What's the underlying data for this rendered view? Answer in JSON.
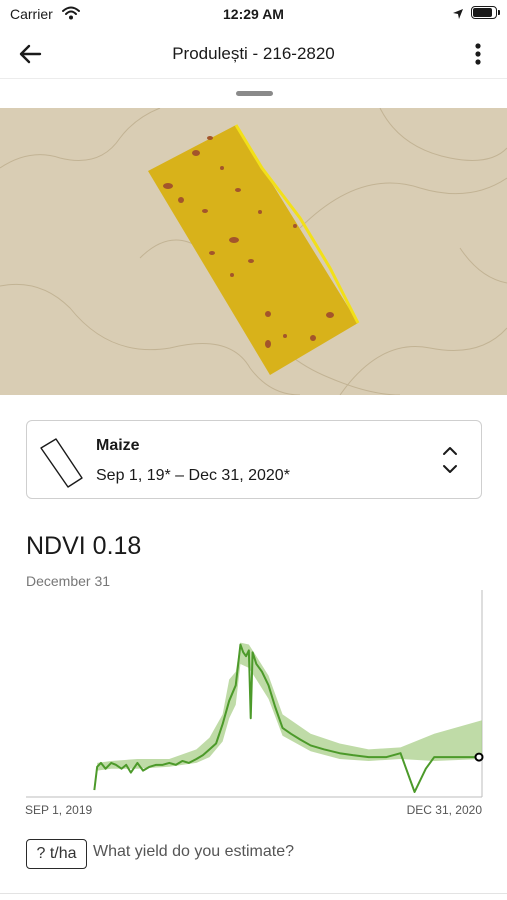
{
  "status_bar": {
    "carrier": "Carrier",
    "time": "12:29 AM",
    "battery_fraction": 0.92
  },
  "nav": {
    "title": "Produlești - 216-2820",
    "back_icon": "arrow-left-icon",
    "more_icon": "vertical-ellipsis-icon"
  },
  "crop": {
    "name": "Maize",
    "date_range": "Sep 1, 19* – Dec 31, 2020*",
    "field_icon": "field-shape-icon",
    "chevron_icon": "up-down-chevron-icon"
  },
  "ndvi": {
    "title": "NDVI 0.18",
    "date": "December 31"
  },
  "colors": {
    "field": "#d8b21a",
    "map_bg": "#d9cdb4",
    "line": "#4c9a2a",
    "band": "#a9cf8a",
    "accent": "#000000"
  },
  "chart_data": {
    "type": "line",
    "xlabel": "",
    "ylabel": "",
    "x_start_label": "SEP 1, 2019",
    "x_end_label": "DEC 31, 2020",
    "x_range": [
      "2019-09-01",
      "2020-12-31"
    ],
    "ylim": [
      0,
      1
    ],
    "series": [
      {
        "points": [
          [
            "2019-11-13",
            0.01
          ],
          [
            "2019-11-16",
            0.13
          ],
          [
            "2019-11-20",
            0.15
          ],
          [
            "2019-11-25",
            0.12
          ],
          [
            "2019-12-01",
            0.15
          ],
          [
            "2019-12-06",
            0.14
          ],
          [
            "2019-12-12",
            0.12
          ],
          [
            "2019-12-17",
            0.14
          ],
          [
            "2019-12-22",
            0.1
          ],
          [
            "2019-12-29",
            0.15
          ],
          [
            "2020-01-04",
            0.11
          ],
          [
            "2020-01-11",
            0.13
          ],
          [
            "2020-01-18",
            0.14
          ],
          [
            "2020-01-25",
            0.14
          ],
          [
            "2020-02-01",
            0.15
          ],
          [
            "2020-02-08",
            0.14
          ],
          [
            "2020-02-15",
            0.16
          ],
          [
            "2020-02-22",
            0.15
          ],
          [
            "2020-03-01",
            0.17
          ],
          [
            "2020-03-08",
            0.19
          ],
          [
            "2020-03-15",
            0.22
          ],
          [
            "2020-03-22",
            0.25
          ],
          [
            "2020-03-29",
            0.35
          ],
          [
            "2020-04-05",
            0.47
          ],
          [
            "2020-04-12",
            0.55
          ],
          [
            "2020-04-17",
            0.76
          ],
          [
            "2020-04-20",
            0.72
          ],
          [
            "2020-04-23",
            0.7
          ],
          [
            "2020-04-26",
            0.73
          ],
          [
            "2020-04-28",
            0.38
          ],
          [
            "2020-04-30",
            0.72
          ],
          [
            "2020-05-04",
            0.66
          ],
          [
            "2020-05-10",
            0.62
          ],
          [
            "2020-05-17",
            0.55
          ],
          [
            "2020-05-24",
            0.44
          ],
          [
            "2020-06-01",
            0.33
          ],
          [
            "2020-06-10",
            0.3
          ],
          [
            "2020-06-20",
            0.27
          ],
          [
            "2020-07-01",
            0.24
          ],
          [
            "2020-07-15",
            0.22
          ],
          [
            "2020-08-01",
            0.2
          ],
          [
            "2020-08-15",
            0.19
          ],
          [
            "2020-09-01",
            0.18
          ],
          [
            "2020-09-20",
            0.18
          ],
          [
            "2020-10-05",
            0.2
          ],
          [
            "2020-10-20",
            0.0
          ],
          [
            "2020-11-01",
            0.12
          ],
          [
            "2020-11-10",
            0.18
          ],
          [
            "2020-12-01",
            0.18
          ],
          [
            "2020-12-31",
            0.18
          ]
        ]
      }
    ],
    "band_upper": [
      [
        "2019-11-16",
        0.15
      ],
      [
        "2019-12-01",
        0.16
      ],
      [
        "2019-12-29",
        0.17
      ],
      [
        "2020-02-01",
        0.17
      ],
      [
        "2020-03-01",
        0.22
      ],
      [
        "2020-03-15",
        0.28
      ],
      [
        "2020-03-29",
        0.4
      ],
      [
        "2020-04-05",
        0.58
      ],
      [
        "2020-04-12",
        0.62
      ],
      [
        "2020-04-17",
        0.77
      ],
      [
        "2020-04-26",
        0.76
      ],
      [
        "2020-05-04",
        0.7
      ],
      [
        "2020-05-17",
        0.6
      ],
      [
        "2020-06-01",
        0.4
      ],
      [
        "2020-07-01",
        0.3
      ],
      [
        "2020-08-01",
        0.25
      ],
      [
        "2020-09-01",
        0.22
      ],
      [
        "2020-10-05",
        0.23
      ],
      [
        "2020-11-10",
        0.3
      ],
      [
        "2020-12-31",
        0.37
      ]
    ],
    "band_lower": [
      [
        "2019-11-16",
        0.11
      ],
      [
        "2019-12-01",
        0.12
      ],
      [
        "2019-12-29",
        0.12
      ],
      [
        "2020-02-01",
        0.13
      ],
      [
        "2020-03-01",
        0.15
      ],
      [
        "2020-03-15",
        0.18
      ],
      [
        "2020-03-29",
        0.26
      ],
      [
        "2020-04-05",
        0.38
      ],
      [
        "2020-04-12",
        0.45
      ],
      [
        "2020-04-17",
        0.66
      ],
      [
        "2020-04-26",
        0.64
      ],
      [
        "2020-05-04",
        0.58
      ],
      [
        "2020-05-17",
        0.48
      ],
      [
        "2020-06-01",
        0.29
      ],
      [
        "2020-07-01",
        0.21
      ],
      [
        "2020-08-01",
        0.17
      ],
      [
        "2020-09-01",
        0.16
      ],
      [
        "2020-10-05",
        0.17
      ],
      [
        "2020-11-10",
        0.16
      ],
      [
        "2020-12-31",
        0.17
      ]
    ],
    "current_point": [
      "2020-12-31",
      0.18
    ],
    "grid": false
  },
  "yield": {
    "button_label": "? t/ha",
    "prompt": "What yield do you estimate?"
  }
}
